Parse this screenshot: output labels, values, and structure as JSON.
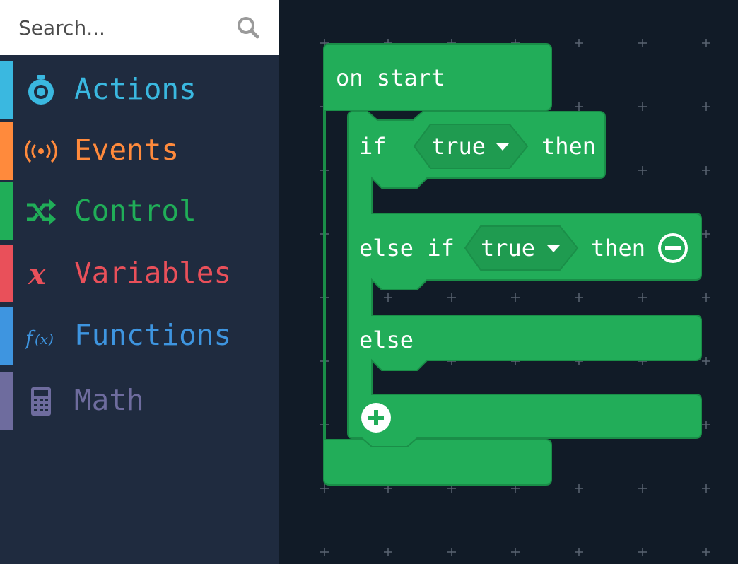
{
  "search": {
    "placeholder": "Search..."
  },
  "sidebar": {
    "categories": [
      {
        "label": "Actions",
        "color": "#3ab8e0",
        "icon": "actions-icon"
      },
      {
        "label": "Events",
        "color": "#ff8a3c",
        "icon": "broadcast-icon"
      },
      {
        "label": "Control",
        "color": "#20ae58",
        "icon": "shuffle-icon"
      },
      {
        "label": "Variables",
        "color": "#e9505a",
        "icon": "variable-x-icon"
      },
      {
        "label": "Functions",
        "color": "#3e95e0",
        "icon": "function-icon"
      },
      {
        "label": "Math",
        "color": "#6e6c9e",
        "icon": "calculator-icon"
      }
    ]
  },
  "blocks": {
    "color": "#22ad59",
    "on_start": "on start",
    "if_label": "if",
    "then_label": "then",
    "else_if_label": "else if",
    "else_label": "else",
    "condition_1": "true",
    "condition_2": "true"
  }
}
